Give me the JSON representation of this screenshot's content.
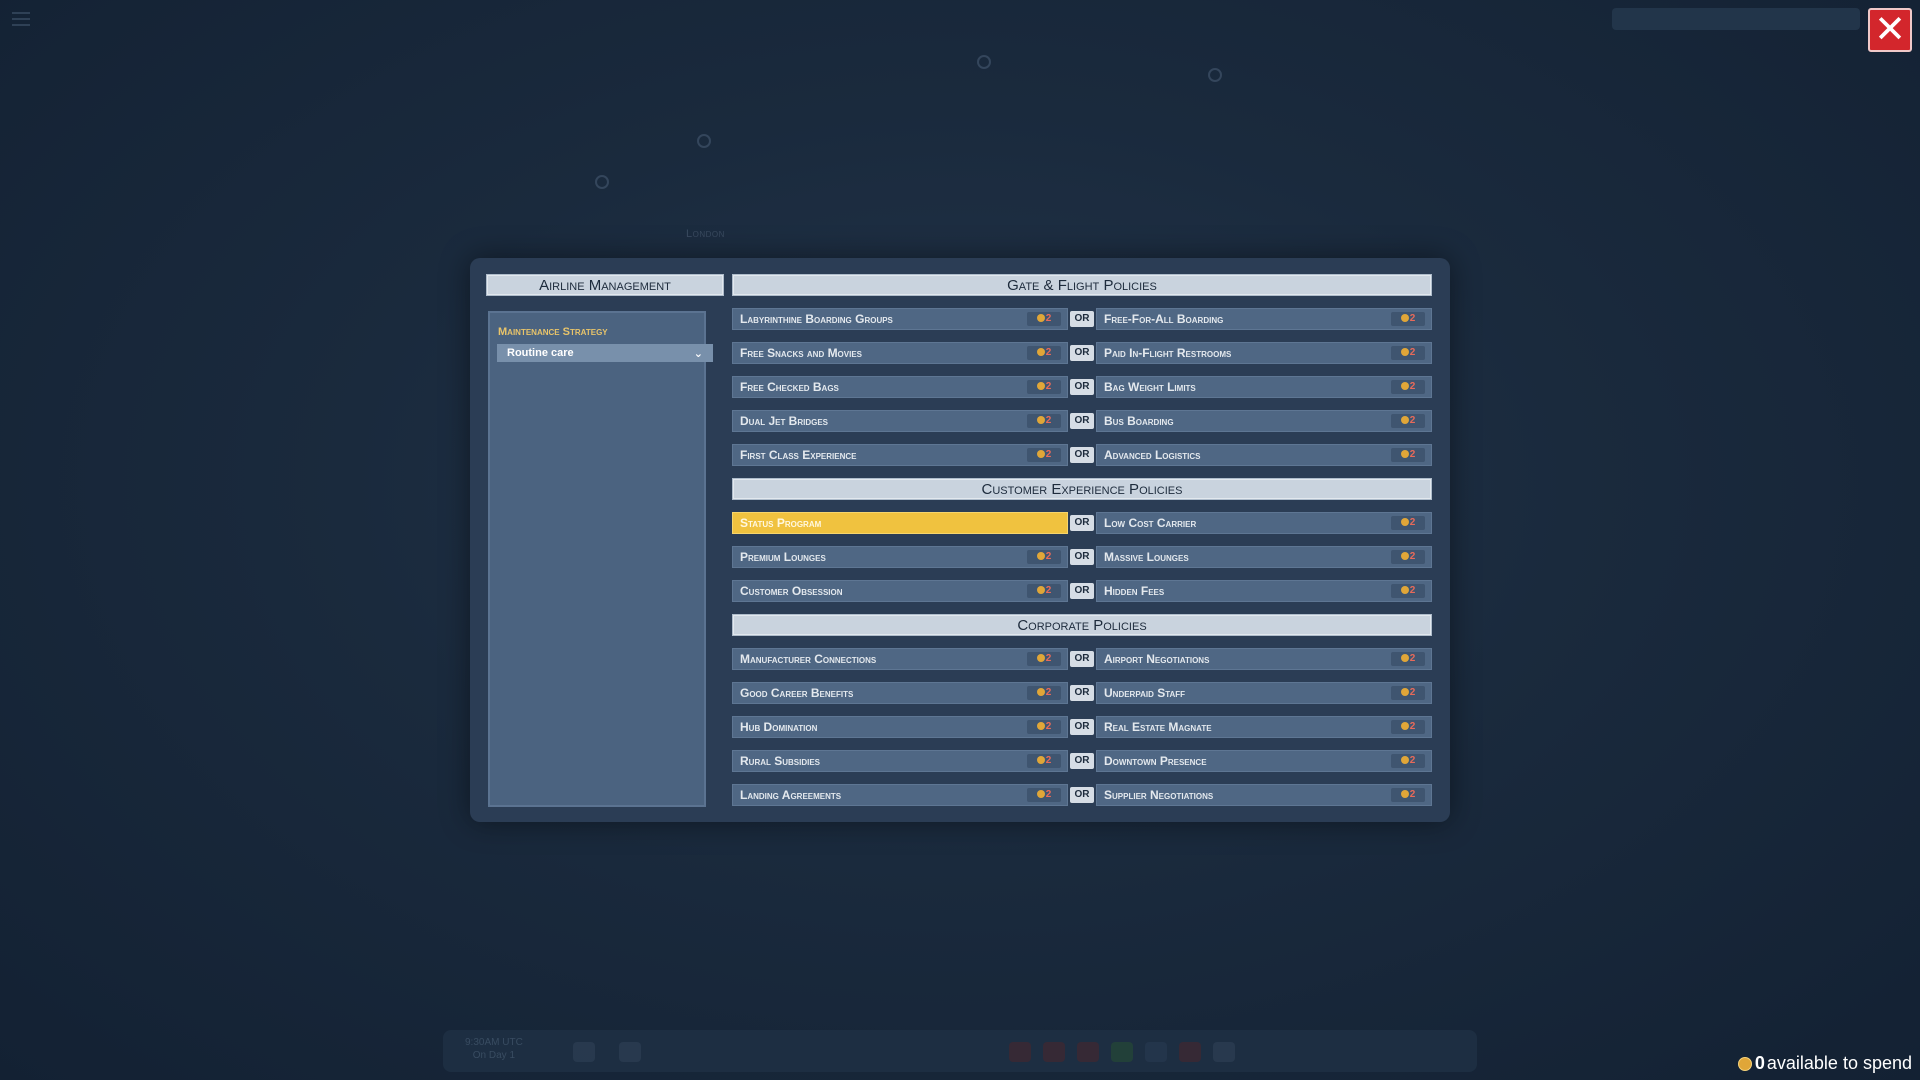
{
  "map": {
    "labels": [
      "London"
    ]
  },
  "notification": "",
  "dialog": {
    "left_title": "Airline Management",
    "maintenance_label": "Maintenance Strategy",
    "maintenance_value": "Routine care",
    "or_label": "OR",
    "sections": [
      {
        "title": "Gate & Flight Policies",
        "pairs": [
          {
            "left": {
              "name": "Labyrinthine Boarding Groups",
              "cost": "2"
            },
            "right": {
              "name": "Free-For-All Boarding",
              "cost": "2"
            }
          },
          {
            "left": {
              "name": "Free Snacks and Movies",
              "cost": "2"
            },
            "right": {
              "name": "Paid In-Flight Restrooms",
              "cost": "2"
            }
          },
          {
            "left": {
              "name": "Free Checked Bags",
              "cost": "2"
            },
            "right": {
              "name": "Bag Weight Limits",
              "cost": "2"
            }
          },
          {
            "left": {
              "name": "Dual Jet Bridges",
              "cost": "2"
            },
            "right": {
              "name": "Bus Boarding",
              "cost": "2"
            }
          },
          {
            "left": {
              "name": "First Class Experience",
              "cost": "2"
            },
            "right": {
              "name": "Advanced Logistics",
              "cost": "2"
            }
          }
        ]
      },
      {
        "title": "Customer Experience Policies",
        "pairs": [
          {
            "left": {
              "name": "Status Program",
              "cost": "",
              "selected": true
            },
            "right": {
              "name": "Low Cost Carrier",
              "cost": "2"
            }
          },
          {
            "left": {
              "name": "Premium Lounges",
              "cost": "2"
            },
            "right": {
              "name": "Massive Lounges",
              "cost": "2"
            }
          },
          {
            "left": {
              "name": "Customer Obsession",
              "cost": "2"
            },
            "right": {
              "name": "Hidden Fees",
              "cost": "2"
            }
          }
        ]
      },
      {
        "title": "Corporate Policies",
        "pairs": [
          {
            "left": {
              "name": "Manufacturer Connections",
              "cost": "2"
            },
            "right": {
              "name": "Airport Negotiations",
              "cost": "2"
            }
          },
          {
            "left": {
              "name": "Good Career Benefits",
              "cost": "2"
            },
            "right": {
              "name": "Underpaid Staff",
              "cost": "2"
            }
          },
          {
            "left": {
              "name": "Hub Domination",
              "cost": "2"
            },
            "right": {
              "name": "Real Estate Magnate",
              "cost": "2"
            }
          },
          {
            "left": {
              "name": "Rural Subsidies",
              "cost": "2"
            },
            "right": {
              "name": "Downtown Presence",
              "cost": "2"
            }
          },
          {
            "left": {
              "name": "Landing Agreements",
              "cost": "2"
            },
            "right": {
              "name": "Supplier Negotiations",
              "cost": "2"
            }
          }
        ]
      }
    ]
  },
  "bottom_bar": {
    "time": "9:30AM UTC",
    "day": "On Day 1"
  },
  "spend": {
    "amount": "0",
    "label": "available to spend"
  },
  "icons": {
    "close": "close-icon",
    "coin": "coin-icon",
    "chevron": "chevron-down-icon",
    "menu": "hamburger-menu-icon"
  },
  "colors": {
    "selected_policy": "#f0c23f",
    "close_button": "#d3262c",
    "cost_text": "#e86a5a",
    "coin": "#e0a638"
  }
}
